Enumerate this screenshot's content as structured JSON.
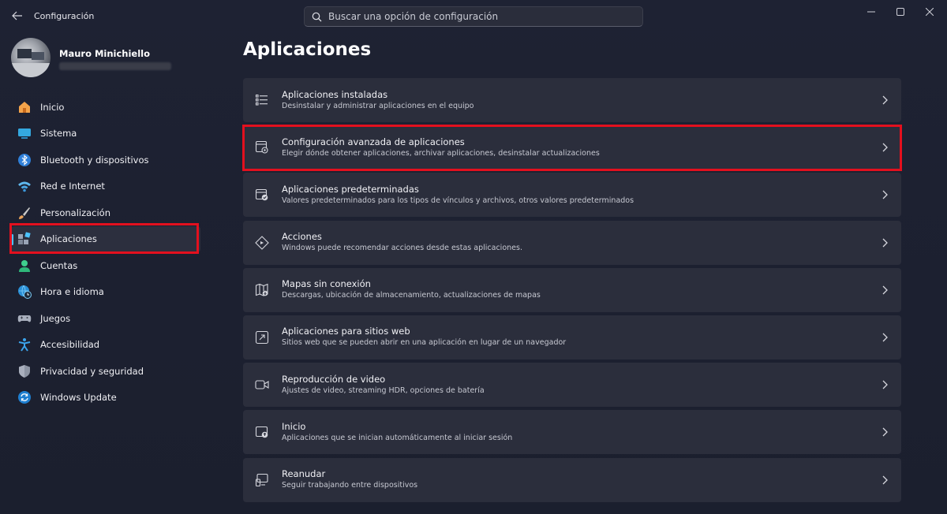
{
  "window": {
    "title": "Configuración",
    "controls": [
      "minimize-icon",
      "maximize-icon",
      "close-icon"
    ]
  },
  "search": {
    "placeholder": "Buscar una opción de configuración"
  },
  "profile": {
    "name": "Mauro Minichiello"
  },
  "sidebar": {
    "items": [
      {
        "label": "Inicio",
        "icon": "home-icon"
      },
      {
        "label": "Sistema",
        "icon": "system-icon"
      },
      {
        "label": "Bluetooth y dispositivos",
        "icon": "bluetooth-icon"
      },
      {
        "label": "Red e Internet",
        "icon": "wifi-icon"
      },
      {
        "label": "Personalización",
        "icon": "brush-icon"
      },
      {
        "label": "Aplicaciones",
        "icon": "apps-icon",
        "selected": true
      },
      {
        "label": "Cuentas",
        "icon": "account-icon"
      },
      {
        "label": "Hora e idioma",
        "icon": "globe-clock-icon"
      },
      {
        "label": "Juegos",
        "icon": "gamepad-icon"
      },
      {
        "label": "Accesibilidad",
        "icon": "accessibility-icon"
      },
      {
        "label": "Privacidad y seguridad",
        "icon": "shield-icon"
      },
      {
        "label": "Windows Update",
        "icon": "update-icon"
      }
    ]
  },
  "main": {
    "title": "Aplicaciones",
    "cards": [
      {
        "title": "Aplicaciones instaladas",
        "subtitle": "Desinstalar y administrar aplicaciones en el equipo",
        "icon": "list-icon"
      },
      {
        "title": "Configuración avanzada de aplicaciones",
        "subtitle": "Elegir dónde obtener aplicaciones, archivar aplicaciones, desinstalar actualizaciones",
        "icon": "app-settings-icon",
        "highlighted": true
      },
      {
        "title": "Aplicaciones predeterminadas",
        "subtitle": "Valores predeterminados para los tipos de vínculos y archivos, otros valores predeterminados",
        "icon": "default-apps-icon"
      },
      {
        "title": "Acciones",
        "subtitle": "Windows puede recomendar acciones desde estas aplicaciones.",
        "icon": "actions-icon"
      },
      {
        "title": "Mapas sin conexión",
        "subtitle": "Descargas, ubicación de almacenamiento, actualizaciones de mapas",
        "icon": "map-icon"
      },
      {
        "title": "Aplicaciones para sitios web",
        "subtitle": "Sitios web que se pueden abrir en una aplicación en lugar de un navegador",
        "icon": "open-external-icon"
      },
      {
        "title": "Reproducción de video",
        "subtitle": "Ajustes de video, streaming HDR, opciones de batería",
        "icon": "video-icon"
      },
      {
        "title": "Inicio",
        "subtitle": "Aplicaciones que se inician automáticamente al iniciar sesión",
        "icon": "startup-icon"
      },
      {
        "title": "Reanudar",
        "subtitle": "Seguir trabajando entre dispositivos",
        "icon": "resume-icon"
      }
    ]
  },
  "colors": {
    "accent": "#4cc2ff",
    "highlight": "#e3101e",
    "card_bg": "#2b2e3c",
    "window_bg": "#1d2030"
  }
}
